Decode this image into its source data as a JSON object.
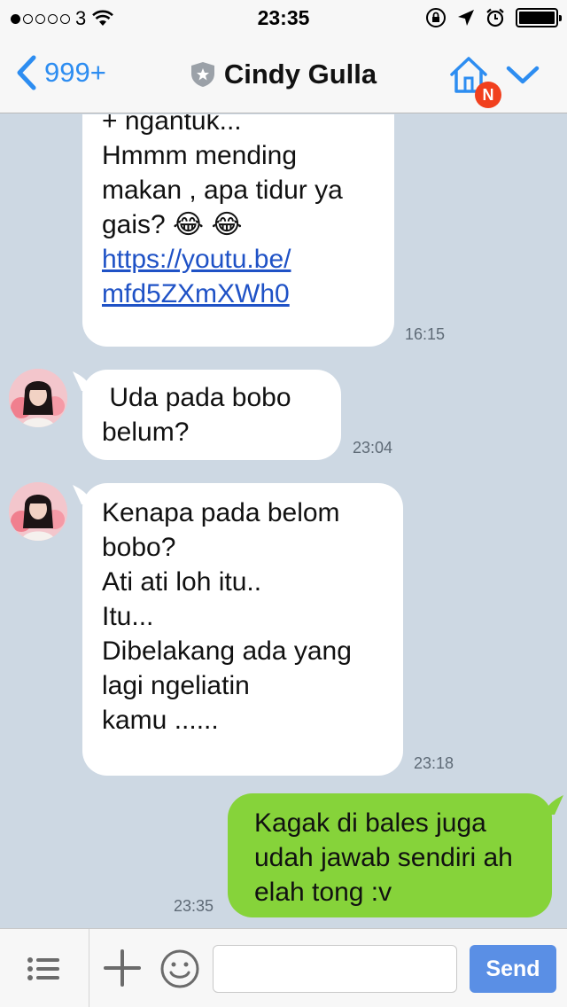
{
  "status_bar": {
    "carrier": "3",
    "time": "23:35"
  },
  "nav": {
    "back_count": "999+",
    "contact_name": "Cindy Gulla",
    "notification_badge": "N"
  },
  "messages": [
    {
      "direction": "incoming",
      "lines": [
        "+ ngantuk...",
        "Hmmm mending",
        "makan , apa tidur ya",
        "gais? 😂 😂",
        "",
        "https://youtu.be/",
        "mfd5ZXmXWh0"
      ],
      "link": "https://youtu.be/mfd5ZXmXWh0",
      "time": "16:15"
    },
    {
      "direction": "incoming",
      "lines": [
        " Uda pada bobo",
        "belum?"
      ],
      "time": "23:04"
    },
    {
      "direction": "incoming",
      "lines": [
        "Kenapa pada belom",
        "bobo?",
        "Ati ati loh itu..",
        "",
        "Itu...",
        "Dibelakang ada yang",
        "lagi ngeliatin",
        "kamu ......"
      ],
      "time": "23:18"
    },
    {
      "direction": "outgoing",
      "lines": [
        "Kagak di bales juga",
        "udah jawab sendiri ah",
        "elah tong :v"
      ],
      "time": "23:35"
    }
  ],
  "input_bar": {
    "placeholder": "",
    "send_label": "Send"
  },
  "colors": {
    "chat_background": "#cdd8e3",
    "outgoing_bubble": "#86d33a",
    "incoming_bubble": "#ffffff",
    "accent": "#2d8df1",
    "send_button": "#5a8fe5",
    "badge": "#f1401e"
  }
}
